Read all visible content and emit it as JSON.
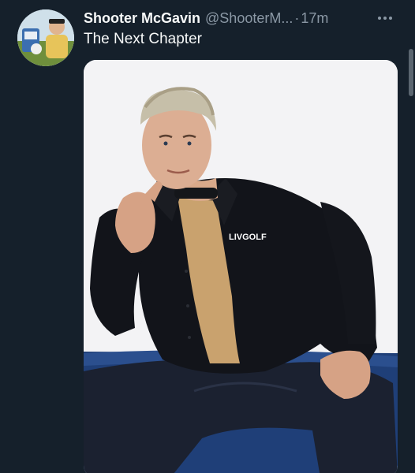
{
  "tweet": {
    "author_name": "Shooter McGavin",
    "handle": "@ShooterM...",
    "separator": "·",
    "time": "17m",
    "text": "The Next Chapter"
  },
  "media": {
    "shirt_logo": "LIVGOLF"
  },
  "icons": {
    "more": "more-horizontal-icon"
  },
  "colors": {
    "background": "#15202b",
    "primary_text": "#f7f9f9",
    "secondary_text": "#8b98a5"
  }
}
